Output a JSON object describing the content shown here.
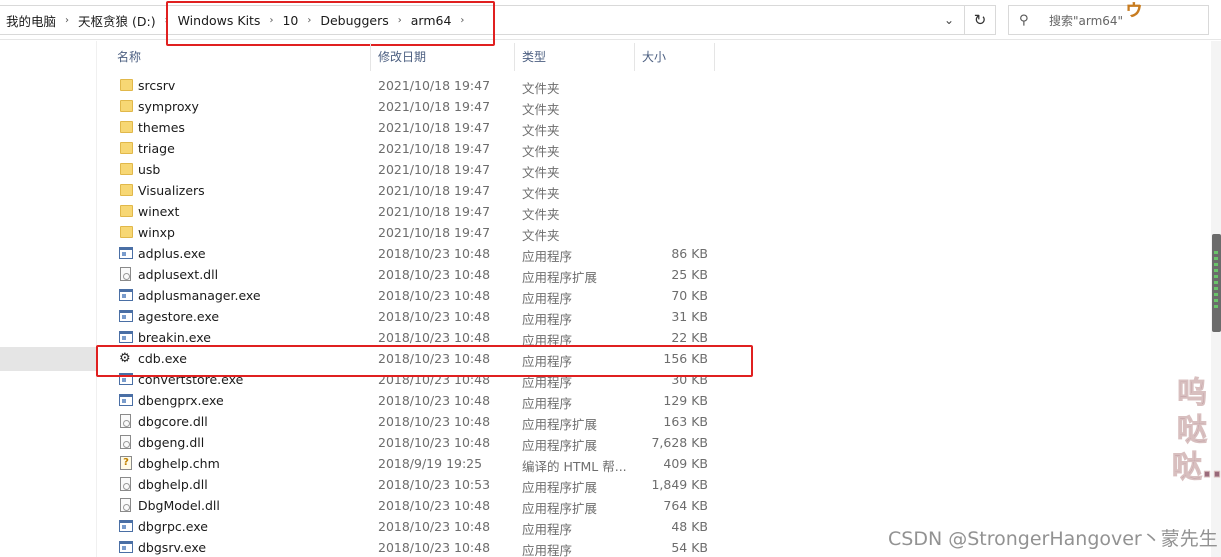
{
  "breadcrumb": {
    "items": [
      "我的电脑",
      "天枢贪狼 (D:)",
      "Windows Kits",
      "10",
      "Debuggers",
      "arm64"
    ]
  },
  "search": {
    "placeholder": "搜索\"arm64\""
  },
  "columns": {
    "name": "名称",
    "date": "修改日期",
    "type": "类型",
    "size": "大小"
  },
  "files": [
    {
      "name": "srcsrv",
      "date": "2021/10/18 19:47",
      "type": "文件夹",
      "size": "",
      "icon": "folder-icon"
    },
    {
      "name": "symproxy",
      "date": "2021/10/18 19:47",
      "type": "文件夹",
      "size": "",
      "icon": "folder-icon"
    },
    {
      "name": "themes",
      "date": "2021/10/18 19:47",
      "type": "文件夹",
      "size": "",
      "icon": "folder-icon"
    },
    {
      "name": "triage",
      "date": "2021/10/18 19:47",
      "type": "文件夹",
      "size": "",
      "icon": "folder-icon"
    },
    {
      "name": "usb",
      "date": "2021/10/18 19:47",
      "type": "文件夹",
      "size": "",
      "icon": "folder-icon"
    },
    {
      "name": "Visualizers",
      "date": "2021/10/18 19:47",
      "type": "文件夹",
      "size": "",
      "icon": "folder-icon"
    },
    {
      "name": "winext",
      "date": "2021/10/18 19:47",
      "type": "文件夹",
      "size": "",
      "icon": "folder-icon"
    },
    {
      "name": "winxp",
      "date": "2021/10/18 19:47",
      "type": "文件夹",
      "size": "",
      "icon": "folder-icon"
    },
    {
      "name": "adplus.exe",
      "date": "2018/10/23 10:48",
      "type": "应用程序",
      "size": "86 KB",
      "icon": "exe-icon"
    },
    {
      "name": "adplusext.dll",
      "date": "2018/10/23 10:48",
      "type": "应用程序扩展",
      "size": "25 KB",
      "icon": "dll-icon"
    },
    {
      "name": "adplusmanager.exe",
      "date": "2018/10/23 10:48",
      "type": "应用程序",
      "size": "70 KB",
      "icon": "exe-icon"
    },
    {
      "name": "agestore.exe",
      "date": "2018/10/23 10:48",
      "type": "应用程序",
      "size": "31 KB",
      "icon": "exe-icon"
    },
    {
      "name": "breakin.exe",
      "date": "2018/10/23 10:48",
      "type": "应用程序",
      "size": "22 KB",
      "icon": "exe-icon"
    },
    {
      "name": "cdb.exe",
      "date": "2018/10/23 10:48",
      "type": "应用程序",
      "size": "156 KB",
      "icon": "debugger-icon"
    },
    {
      "name": "convertstore.exe",
      "date": "2018/10/23 10:48",
      "type": "应用程序",
      "size": "30 KB",
      "icon": "exe-icon"
    },
    {
      "name": "dbengprx.exe",
      "date": "2018/10/23 10:48",
      "type": "应用程序",
      "size": "129 KB",
      "icon": "exe-icon"
    },
    {
      "name": "dbgcore.dll",
      "date": "2018/10/23 10:48",
      "type": "应用程序扩展",
      "size": "163 KB",
      "icon": "dll-icon"
    },
    {
      "name": "dbgeng.dll",
      "date": "2018/10/23 10:48",
      "type": "应用程序扩展",
      "size": "7,628 KB",
      "icon": "dll-icon"
    },
    {
      "name": "dbghelp.chm",
      "date": "2018/9/19 19:25",
      "type": "编译的 HTML 帮...",
      "size": "409 KB",
      "icon": "help-icon"
    },
    {
      "name": "dbghelp.dll",
      "date": "2018/10/23 10:53",
      "type": "应用程序扩展",
      "size": "1,849 KB",
      "icon": "dll-icon"
    },
    {
      "name": "DbgModel.dll",
      "date": "2018/10/23 10:48",
      "type": "应用程序扩展",
      "size": "764 KB",
      "icon": "dll-icon"
    },
    {
      "name": "dbgrpc.exe",
      "date": "2018/10/23 10:48",
      "type": "应用程序",
      "size": "48 KB",
      "icon": "exe-icon"
    },
    {
      "name": "dbgsrv.exe",
      "date": "2018/10/23 10:48",
      "type": "应用程序",
      "size": "54 KB",
      "icon": "exe-icon"
    }
  ],
  "watermark": {
    "vertical": "呜哒哒…",
    "csdn": "CSDN @StrongerHangover丶蒙先生"
  },
  "colors": {
    "highlight_box": "#e02020",
    "header_text": "#4d6082",
    "folder": "#f7d774"
  }
}
